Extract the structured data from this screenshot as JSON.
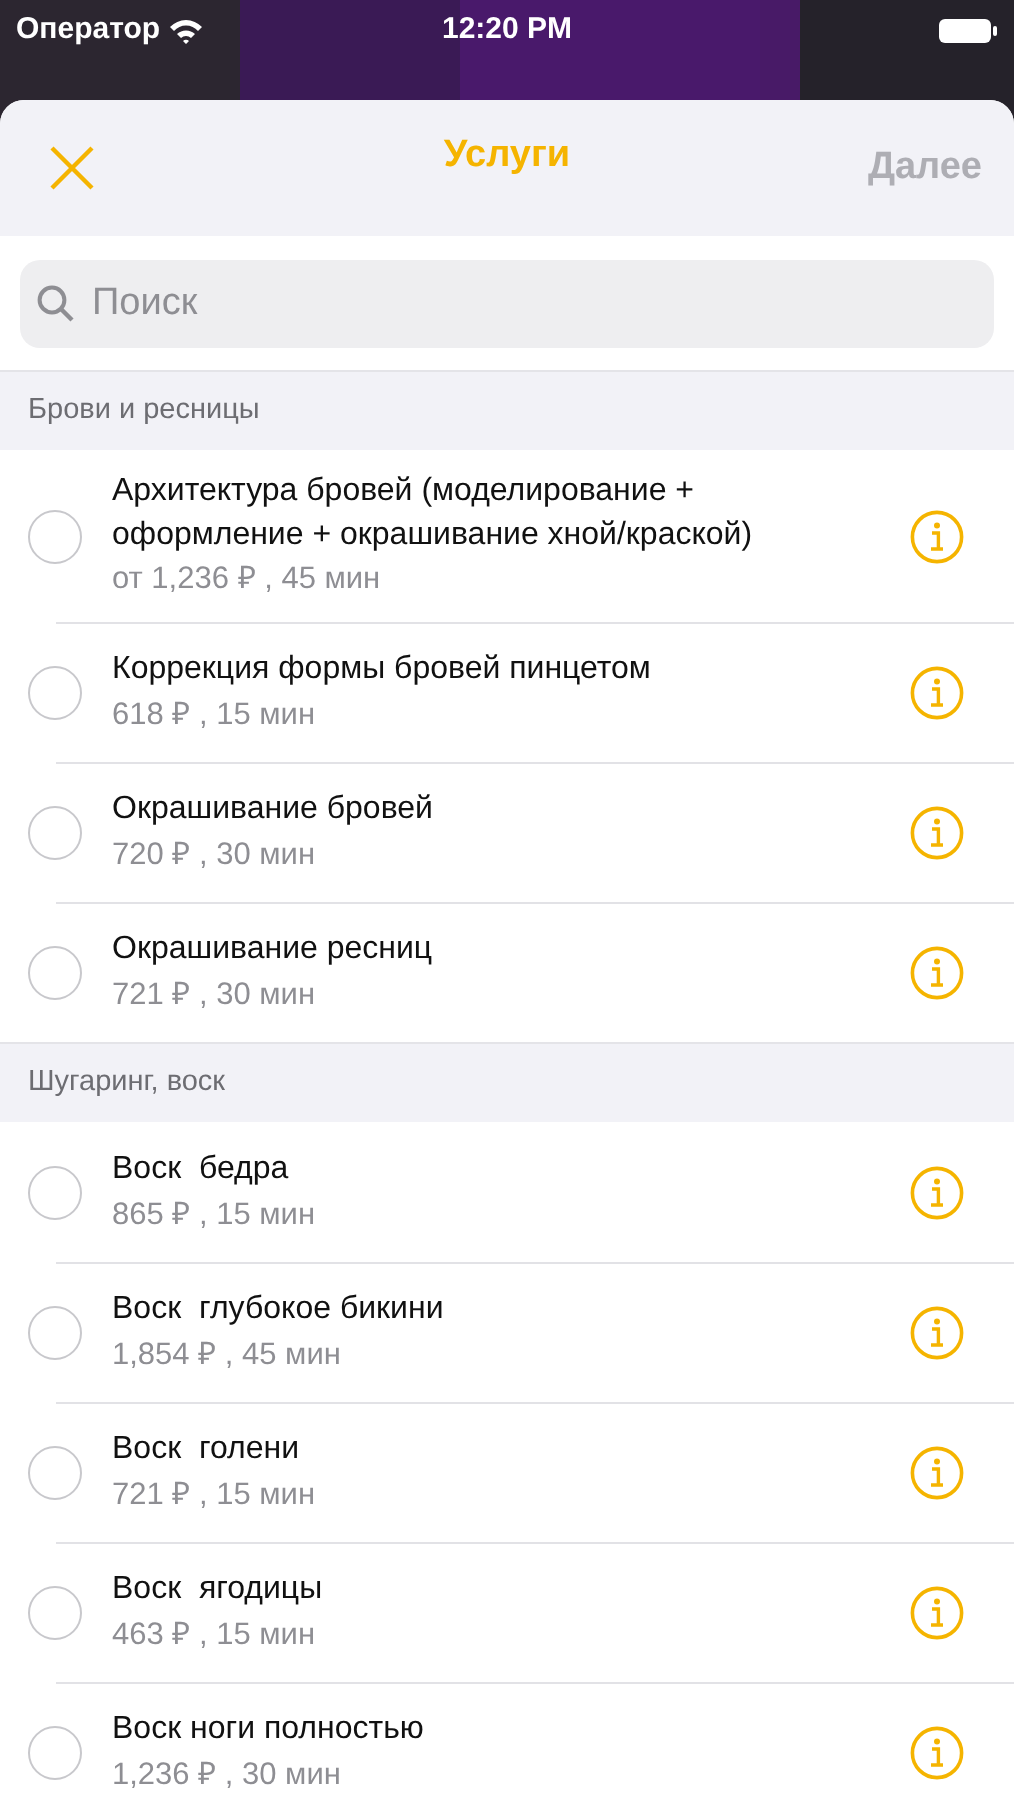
{
  "status_bar": {
    "carrier": "Оператор",
    "time": "12:20 PM"
  },
  "header": {
    "title": "Услуги",
    "next": {
      "label": "Далее",
      "disabled": true
    }
  },
  "search": {
    "placeholder": "Поиск"
  },
  "sections": [
    {
      "title": "Брови и ресницы",
      "items": [
        {
          "name": "Архитектура бровей (моделирование + оформление + окрашивание хной/краской)",
          "details": "от 1,236 ₽ , 45 мин",
          "selected": false
        },
        {
          "name": "Коррекция формы бровей пинцетом",
          "details": "618 ₽ , 15 мин",
          "selected": false
        },
        {
          "name": "Окрашивание бровей",
          "details": "720 ₽ , 30 мин",
          "selected": false
        },
        {
          "name": "Окрашивание ресниц",
          "details": "721 ₽ , 30 мин",
          "selected": false
        }
      ]
    },
    {
      "title": "Шугаринг, воск",
      "items": [
        {
          "name": "Воск  бедра",
          "details": "865 ₽ , 15 мин",
          "selected": false
        },
        {
          "name": "Воск  глубокое бикини",
          "details": "1,854 ₽ , 45 мин",
          "selected": false
        },
        {
          "name": "Воск  голени",
          "details": "721 ₽ , 15 мин",
          "selected": false
        },
        {
          "name": "Воск  ягодицы",
          "details": "463 ₽ , 15 мин",
          "selected": false
        },
        {
          "name": "Воск ноги полностью",
          "details": "1,236 ₽ , 30 мин",
          "selected": false
        }
      ]
    }
  ]
}
